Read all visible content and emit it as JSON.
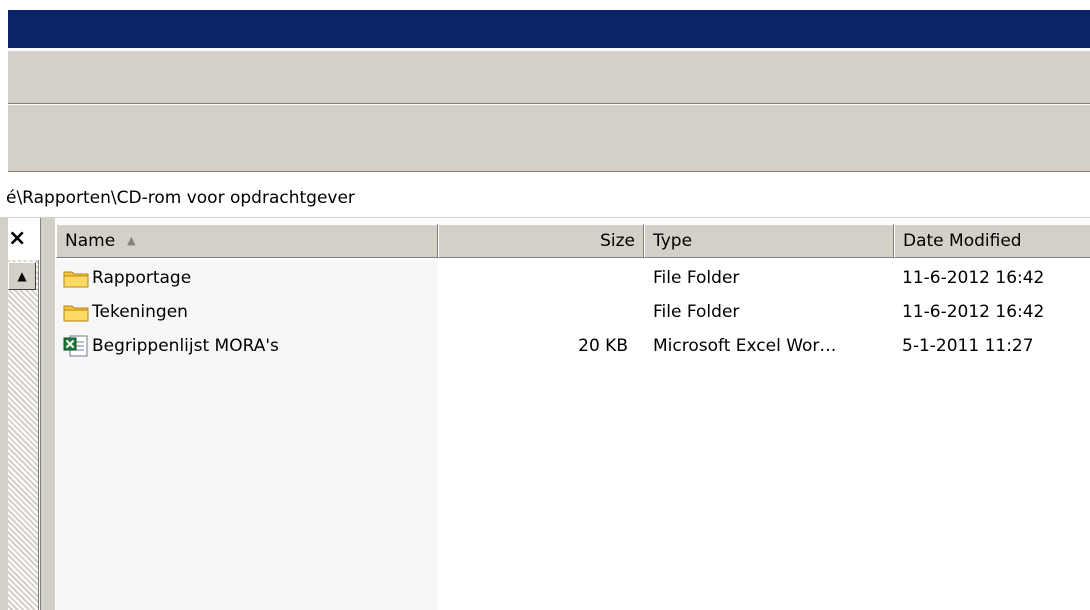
{
  "address": {
    "path": "é\\Rapporten\\CD-rom voor opdrachtgever"
  },
  "columns": {
    "name": "Name",
    "size": "Size",
    "type": "Type",
    "date": "Date Modified"
  },
  "files": [
    {
      "name": "Rapportage",
      "size": "",
      "type": "File Folder",
      "date": "11-6-2012 16:42",
      "icon": "folder-icon"
    },
    {
      "name": "Tekeningen",
      "size": "",
      "type": "File Folder",
      "date": "11-6-2012 16:42",
      "icon": "folder-icon"
    },
    {
      "name": "Begrippenlijst MORA's",
      "size": "20 KB",
      "type": "Microsoft Excel Wor…",
      "date": "5-1-2011 11:27",
      "icon": "excel-file-icon"
    }
  ],
  "colors": {
    "title_bar": "#0a246a",
    "chrome": "#d4d0c8",
    "folder": "#f4c542"
  }
}
